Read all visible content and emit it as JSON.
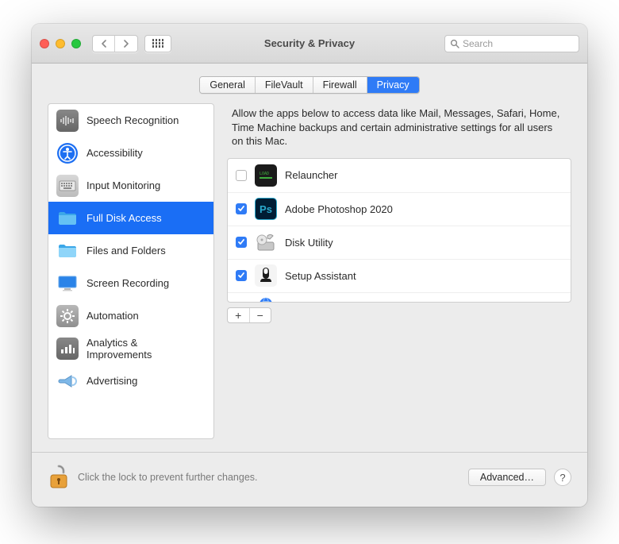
{
  "window_title": "Security & Privacy",
  "search": {
    "placeholder": "Search"
  },
  "tabs": [
    "General",
    "FileVault",
    "Firewall",
    "Privacy"
  ],
  "selected_tab": 3,
  "sidebar": {
    "items": [
      {
        "label": "Speech Recognition",
        "icon": "waveform-icon"
      },
      {
        "label": "Accessibility",
        "icon": "accessibility-icon"
      },
      {
        "label": "Input Monitoring",
        "icon": "keyboard-icon"
      },
      {
        "label": "Full Disk Access",
        "icon": "folder-icon"
      },
      {
        "label": "Files and Folders",
        "icon": "folder-open-icon"
      },
      {
        "label": "Screen Recording",
        "icon": "display-icon"
      },
      {
        "label": "Automation",
        "icon": "gear-icon"
      },
      {
        "label": "Analytics & Improvements",
        "icon": "chart-icon"
      },
      {
        "label": "Advertising",
        "icon": "megaphone-icon"
      }
    ],
    "selected": 3
  },
  "main": {
    "description": "Allow the apps below to access data like Mail, Messages, Safari, Home, Time Machine backups and certain administrative settings for all users on this Mac.",
    "apps": [
      {
        "label": "Relauncher",
        "checked": false,
        "icon": "terminal-icon"
      },
      {
        "label": "Adobe Photoshop 2020",
        "checked": true,
        "icon": "photoshop-icon"
      },
      {
        "label": "Disk Utility",
        "checked": true,
        "icon": "diskutility-icon"
      },
      {
        "label": "Setup Assistant",
        "checked": true,
        "icon": "assistant-icon"
      }
    ]
  },
  "footer": {
    "lock_text": "Click the lock to prevent further changes.",
    "advanced_label": "Advanced…"
  }
}
